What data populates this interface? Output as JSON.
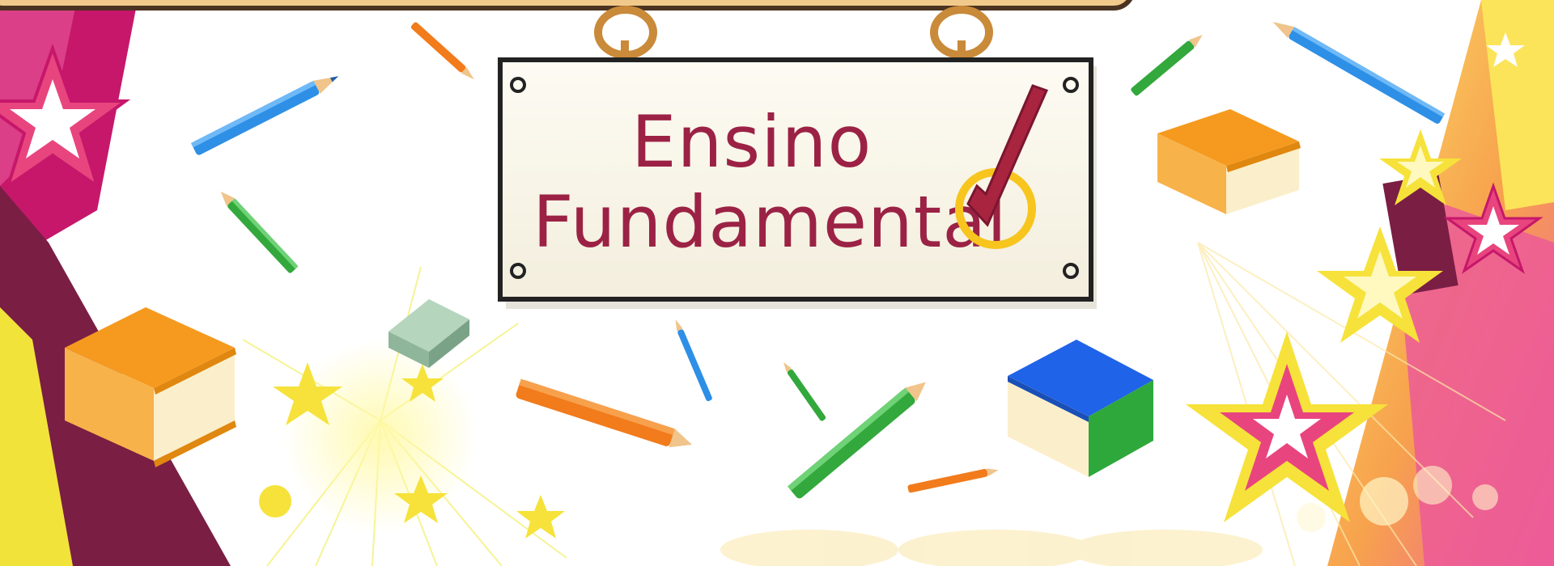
{
  "sign": {
    "line1": "Ensino",
    "line2": "Fundamental"
  },
  "colors": {
    "sign_text": "#9b2245",
    "sign_board": "#fbf8ee",
    "rope": "#c98a3a",
    "check_mark": "#a8243f",
    "check_circle": "#f7c51e",
    "book_orange": "#f59a1e",
    "book_blue": "#1f63e8",
    "book_green": "#2fa83b",
    "eraser": "#8fb59a",
    "star_yellow": "#f6e23a",
    "star_pink": "#e8457e",
    "maroon": "#7a1e44",
    "magenta": "#c6176b"
  },
  "icons": [
    "pencil-icon",
    "book-icon",
    "eraser-icon",
    "star-icon",
    "check-icon"
  ]
}
